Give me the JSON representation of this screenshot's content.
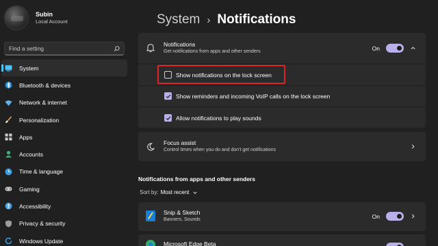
{
  "profile": {
    "name": "Subin",
    "account": "Local Account"
  },
  "search": {
    "placeholder": "Find a setting"
  },
  "sidebar": {
    "items": [
      {
        "label": "System",
        "icon": "system-icon",
        "active": true
      },
      {
        "label": "Bluetooth & devices",
        "icon": "bluetooth-icon"
      },
      {
        "label": "Network & internet",
        "icon": "network-icon"
      },
      {
        "label": "Personalization",
        "icon": "brush-icon"
      },
      {
        "label": "Apps",
        "icon": "apps-icon"
      },
      {
        "label": "Accounts",
        "icon": "accounts-icon"
      },
      {
        "label": "Time & language",
        "icon": "globe-clock-icon"
      },
      {
        "label": "Gaming",
        "icon": "gamepad-icon"
      },
      {
        "label": "Accessibility",
        "icon": "accessibility-icon"
      },
      {
        "label": "Privacy & security",
        "icon": "shield-icon"
      },
      {
        "label": "Windows Update",
        "icon": "update-icon"
      }
    ]
  },
  "breadcrumb": {
    "parent": "System",
    "separator": "›",
    "current": "Notifications"
  },
  "notifications": {
    "title": "Notifications",
    "subtitle": "Get notifications from apps and other senders",
    "state": "On",
    "options": [
      {
        "label": "Show notifications on the lock screen",
        "checked": false,
        "highlighted": true
      },
      {
        "label": "Show reminders and incoming VoIP calls on the lock screen",
        "checked": true
      },
      {
        "label": "Allow notifications to play sounds",
        "checked": true
      }
    ]
  },
  "focus_assist": {
    "title": "Focus assist",
    "subtitle": "Control times when you do and don't get notifications"
  },
  "senders": {
    "heading": "Notifications from apps and other senders",
    "sort_label": "Sort by:",
    "sort_value": "Most recent",
    "apps": [
      {
        "name": "Snip & Sketch",
        "detail": "Banners, Sounds",
        "state": "On"
      },
      {
        "name": "Microsoft Edge Beta",
        "detail": "",
        "state": ""
      }
    ]
  },
  "colors": {
    "accent": "#b9b0ea",
    "highlight": "#e0242a",
    "background": "#202020",
    "card": "#2b2b2b",
    "nav_indicator": "#4cc2ff"
  }
}
